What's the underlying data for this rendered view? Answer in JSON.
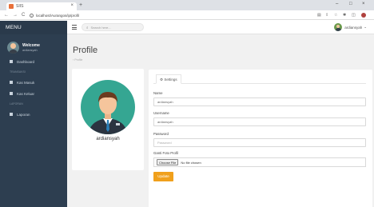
{
  "browser": {
    "tab_title": "SIIS",
    "url": "localhost/Aurangos/ip/profil",
    "new_tab": "+",
    "tab_close": "×",
    "minimize": "–",
    "maximize": "□",
    "close": "×",
    "back": "←",
    "forward": "→",
    "reload": "C"
  },
  "sidebar": {
    "menu_title": "MENU",
    "user_welcome": "Welcome",
    "user_name": "ardiansyah",
    "items": [
      {
        "type": "item",
        "label": "Dashboard"
      },
      {
        "type": "category",
        "label": "TRANSAKSI"
      },
      {
        "type": "item",
        "label": "Kas Masuk"
      },
      {
        "type": "item",
        "label": "Kas Keluar"
      },
      {
        "type": "category",
        "label": "LAPORAN"
      },
      {
        "type": "item",
        "label": "Laporan"
      }
    ]
  },
  "topbar": {
    "search_placeholder": "Search here...",
    "user_label": "ardiansyah"
  },
  "page": {
    "title": "Profile",
    "breadcrumb": "› Profile"
  },
  "profile_card": {
    "name": "ardiansyah"
  },
  "settings": {
    "tab_label": "Settings",
    "fields": {
      "name_label": "Name",
      "name_value": "ardiansyah",
      "username_label": "Username",
      "username_value": "ardiansyah",
      "password_label": "Password",
      "password_placeholder": "Password",
      "photo_label": "Ganti Foto Profil",
      "choose_file": "Choose File",
      "no_file": "No file chosen"
    },
    "update_button": "Update"
  },
  "colors": {
    "sidebar_bg": "#2d3e50",
    "update_button": "#f0a01c",
    "avatar_bg": "#35a692"
  }
}
